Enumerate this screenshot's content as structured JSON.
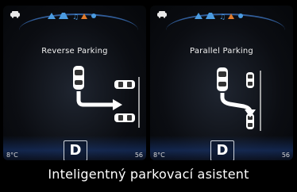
{
  "screens": [
    {
      "mode_title": "Reverse Parking",
      "gear": "D",
      "temperature": "8°C",
      "speed": "56"
    },
    {
      "mode_title": "Parallel Parking",
      "gear": "D",
      "temperature": "8°C",
      "speed": "56"
    }
  ],
  "caption": "Inteligentný parkovací asistent",
  "colors": {
    "arc_blue": "#3f79c8",
    "status_icons_blue": "#4b9be0",
    "status_icon_orange": "#e07a2b"
  },
  "icons": {
    "top_left": "car-icon",
    "status": [
      "warning-icon",
      "road-icon",
      "music-icon",
      "alert-icon",
      "settings-icon"
    ]
  }
}
